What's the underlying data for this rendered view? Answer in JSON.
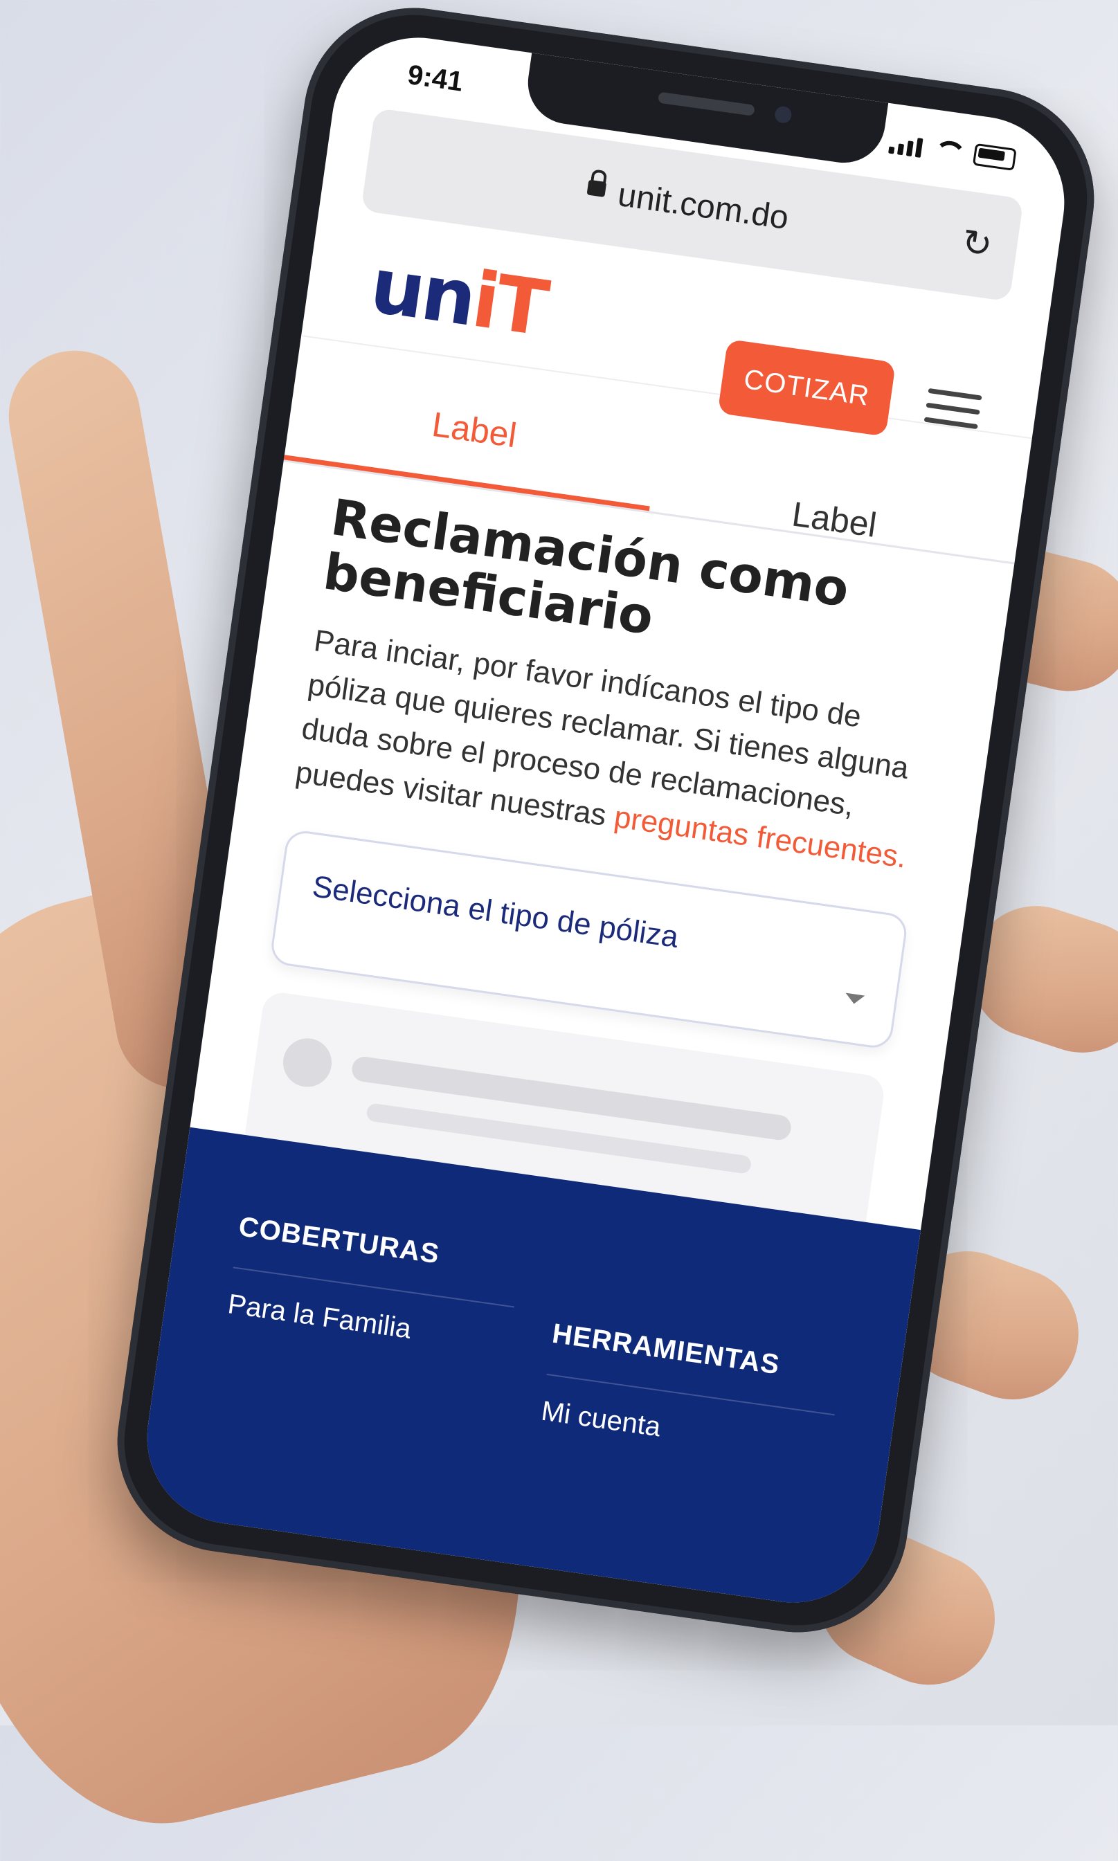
{
  "status_bar": {
    "time": "9:41"
  },
  "browser": {
    "url": "unit.com.do",
    "reload_icon": "↻"
  },
  "header": {
    "logo_part1": "un",
    "logo_part2": "iT",
    "cotizar_label": "COTIZAR"
  },
  "tabs": [
    {
      "label": "Label",
      "active": true
    },
    {
      "label": "Label",
      "active": false
    }
  ],
  "main": {
    "title": "Reclamación como beneficiario",
    "description": "Para inciar, por favor indícanos el tipo de póliza que quieres reclamar. Si tienes alguna duda sobre el proceso de reclamaciones, puedes visitar nuestras",
    "faq_link": "preguntas frecuentes.",
    "select_placeholder": "Selecciona el tipo de póliza"
  },
  "footer": {
    "col1_title": "COBERTURAS",
    "col1_link": "Para la Familia",
    "col2_title": "HERRAMIENTAS",
    "col2_link": "Mi cuenta"
  },
  "colors": {
    "brand_blue": "#1b2b7a",
    "brand_orange": "#f25a38",
    "footer_bg": "#102a7a"
  }
}
